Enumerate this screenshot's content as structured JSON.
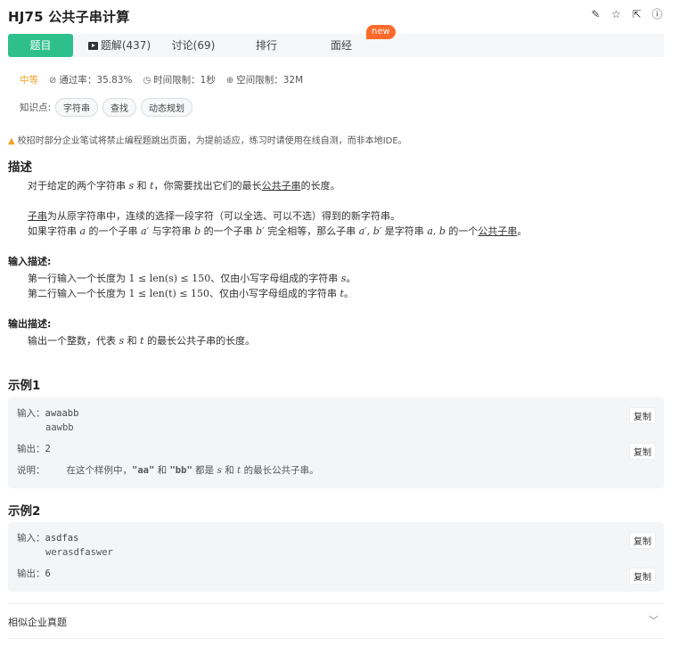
{
  "problem": {
    "id_title": "HJ75  公共子串计算"
  },
  "toolbar_icons": [
    "edit-icon",
    "star-icon",
    "share-icon",
    "info-icon"
  ],
  "tabs": [
    {
      "label": "题目"
    },
    {
      "label": "题解(437)"
    },
    {
      "label": "讨论(69)"
    },
    {
      "label": "排行"
    },
    {
      "label": "面经"
    }
  ],
  "new_badge": "new",
  "meta": {
    "difficulty": "中等",
    "pass_rate": "通过率：35.83%",
    "time_limit": "时间限制：1秒",
    "space_limit": "空间限制：32M"
  },
  "knowledge": {
    "label": "知识点:",
    "tags": [
      "字符串",
      "查找",
      "动态规划"
    ]
  },
  "warning": "校招时部分企业笔试将禁止编程题跳出页面，为提前适应，练习时请使用在线自测，而非本地IDE。",
  "description": {
    "heading": "描述",
    "line1_a": "对于给定的两个字符串 ",
    "line1_s": "s",
    "line1_b": " 和 ",
    "line1_t": "t",
    "line1_c": "，你需要找出它们的最长",
    "line1_link": "公共子串",
    "line1_d": "的长度。",
    "line2_a": "子串",
    "line2_b": "为从原字符串中，连续的选择一段字符（可以全选、可以不选）得到的新字符串。",
    "line3_a": "如果字符串 ",
    "line3_m1": "a",
    "line3_b": " 的一个子串 ",
    "line3_m2": "a′",
    "line3_c": " 与字符串 ",
    "line3_m3": "b",
    "line3_d": " 的一个子串 ",
    "line3_m4": "b′",
    "line3_e": " 完全相等，那么子串 ",
    "line3_m5": "a′, b′",
    "line3_f": " 是字符串 ",
    "line3_m6": "a, b",
    "line3_g": " 的一个",
    "line3_link": "公共子串",
    "line3_h": "。"
  },
  "input_desc": {
    "heading": "输入描述:",
    "line1_a": "第一行输入一个长度为 ",
    "line1_m": "1 ≤ len(s) ≤ 150",
    "line1_b": "、仅由小写字母组成的字符串 ",
    "line1_v": "s",
    "line1_c": "。",
    "line2_a": "第二行输入一个长度为 ",
    "line2_m": "1 ≤ len(t) ≤ 150",
    "line2_b": "、仅由小写字母组成的字符串 ",
    "line2_v": "t",
    "line2_c": "。"
  },
  "output_desc": {
    "heading": "输出描述:",
    "line_a": "输出一个整数，代表 ",
    "line_s": "s",
    "line_b": " 和 ",
    "line_t": "t",
    "line_c": " 的最长公共子串的长度。"
  },
  "example1": {
    "heading": "示例1",
    "input_label": "输入：",
    "input_line1": "awaabb",
    "input_line2": "aawbb",
    "output_label": "输出：",
    "output": "2",
    "explain_label": "说明：",
    "explain_a": "在这个样例中，",
    "explain_q1": "\"aa\"",
    "explain_b": " 和 ",
    "explain_q2": "\"bb\"",
    "explain_c": " 都是 ",
    "explain_s": "s",
    "explain_d": " 和 ",
    "explain_t": "t",
    "explain_e": " 的最长公共子串。",
    "copy": "复制"
  },
  "example2": {
    "heading": "示例2",
    "input_label": "输入：",
    "input_line1": "asdfas",
    "input_line2": "werasdfaswer",
    "output_label": "输出：",
    "output": "6",
    "copy": "复制"
  },
  "similar": {
    "label": "相似企业真题"
  }
}
